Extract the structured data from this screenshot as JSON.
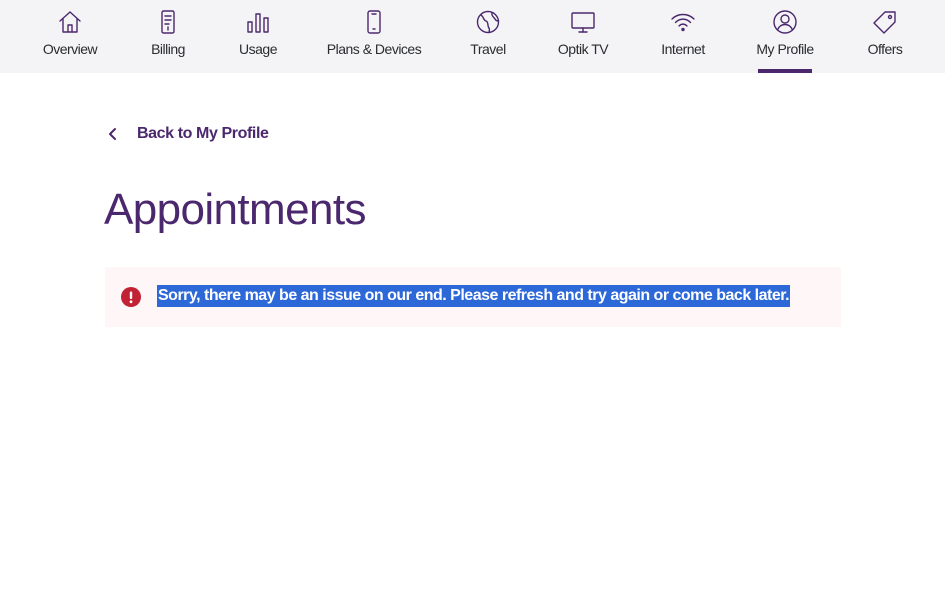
{
  "nav": {
    "items": [
      {
        "label": "Overview",
        "icon": "home-icon"
      },
      {
        "label": "Billing",
        "icon": "bill-icon"
      },
      {
        "label": "Usage",
        "icon": "bar-chart-icon"
      },
      {
        "label": "Plans & Devices",
        "icon": "phone-icon"
      },
      {
        "label": "Travel",
        "icon": "globe-icon"
      },
      {
        "label": "Optik TV",
        "icon": "tv-icon"
      },
      {
        "label": "Internet",
        "icon": "wifi-icon"
      },
      {
        "label": "My Profile",
        "icon": "user-icon"
      },
      {
        "label": "Offers",
        "icon": "tag-icon"
      }
    ],
    "active_index": 7
  },
  "back_link": {
    "label": "Back to My Profile",
    "icon": "chevron-left-icon"
  },
  "page": {
    "title": "Appointments"
  },
  "alert": {
    "icon": "error-icon",
    "message": "Sorry, there may be an issue on our end. Please refresh and try again or come back later."
  },
  "colors": {
    "brand": "#4b286d",
    "nav_background": "#f4f4f7",
    "alert_background": "#fff6f8",
    "error": "#c12335",
    "selection": "#2d68d8"
  }
}
